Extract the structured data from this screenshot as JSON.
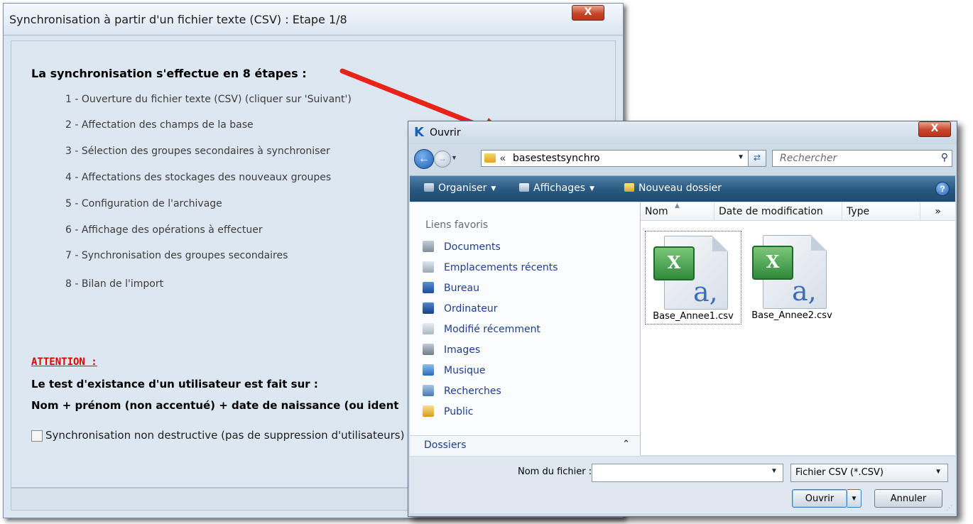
{
  "wizard": {
    "title": "Synchronisation à partir d'un fichier texte (CSV) : Etape 1/8",
    "close_label": "X",
    "heading": "La synchronisation s'effectue en 8 étapes :",
    "steps": [
      "1 - Ouverture du fichier texte (CSV) (cliquer sur 'Suivant')",
      "2 - Affectation des champs de la base",
      "3 - Sélection des groupes secondaires à synchroniser",
      "4 - Affectations des stockages des nouveaux groupes",
      "5 - Configuration de l'archivage",
      "6 - Affichage des opérations à effectuer",
      "7 - Synchronisation des groupes secondaires",
      "8 - Bilan de l'import"
    ],
    "attention": "ATTENTION :",
    "warning_line1": "Le test d'existance d'un utilisateur est fait sur :",
    "warning_line2": "Nom +  prénom (non accentué) + date de naissance (ou ident",
    "checkbox_label": "Synchronisation non destructive (pas de suppression d'utilisateurs)",
    "checkbox_checked": false
  },
  "dialog": {
    "title": "Ouvrir",
    "logo": "K",
    "close_label": "X",
    "address": {
      "chevron": "«",
      "path": "basestestsynchro"
    },
    "search_placeholder": "Rechercher",
    "toolbar": {
      "organize": "Organiser",
      "views": "Affichages",
      "new_folder": "Nouveau dossier"
    },
    "favorites_header": "Liens favoris",
    "favorites": [
      {
        "label": "Documents",
        "icon": "documents-icon"
      },
      {
        "label": "Emplacements récents",
        "icon": "recent-places-icon"
      },
      {
        "label": "Bureau",
        "icon": "desktop-icon"
      },
      {
        "label": "Ordinateur",
        "icon": "computer-icon"
      },
      {
        "label": "Modifié récemment",
        "icon": "recently-changed-icon"
      },
      {
        "label": "Images",
        "icon": "pictures-icon"
      },
      {
        "label": "Musique",
        "icon": "music-icon"
      },
      {
        "label": "Recherches",
        "icon": "searches-icon"
      },
      {
        "label": "Public",
        "icon": "public-folder-icon"
      }
    ],
    "folders_label": "Dossiers",
    "columns": [
      "Nom",
      "Date de modification",
      "Type",
      "»"
    ],
    "files": [
      {
        "name": "Base_Annee1.csv",
        "selected": true
      },
      {
        "name": "Base_Annee2.csv",
        "selected": false
      }
    ],
    "filename_label": "Nom du fichier :",
    "filename_value": "",
    "filetype": "Fichier CSV (*.CSV)",
    "open_button": "Ouvrir",
    "cancel_button": "Annuler"
  },
  "colors": {
    "arrow": "#e8231a",
    "toolbar": "#2b5a82",
    "link": "#1e3e8c",
    "attention": "#e00000"
  }
}
